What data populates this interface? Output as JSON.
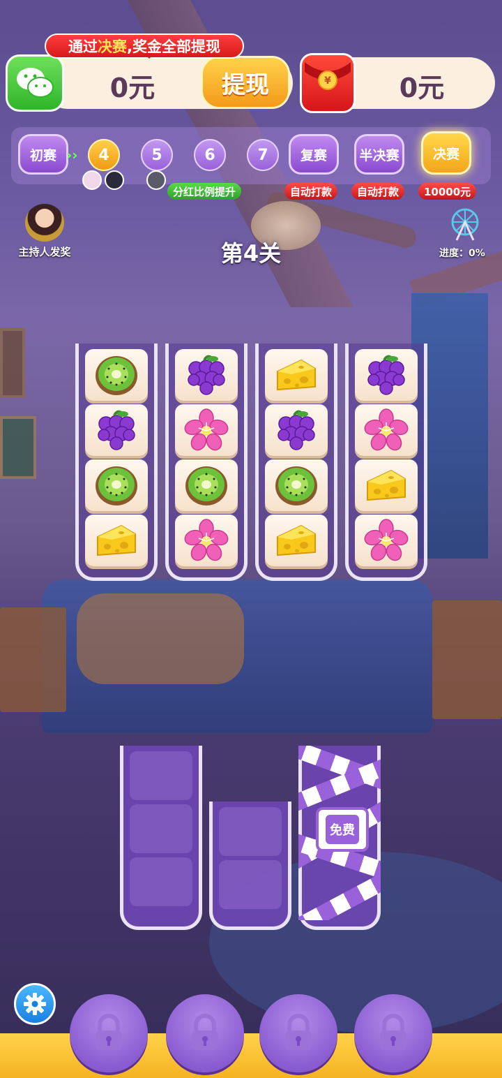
{
  "wallet": {
    "banner_prefix": "通过",
    "banner_highlight": "决赛",
    "banner_suffix": ",奖金全部提现",
    "cash_amount": "0元",
    "withdraw_label": "提现",
    "redpack_amount": "0元"
  },
  "stages": {
    "start": "初赛",
    "levels": [
      "4",
      "5",
      "6",
      "7"
    ],
    "current": "4",
    "repechage": "复赛",
    "semifinal": "半决赛",
    "final": "决赛",
    "tag_dividend": "分红比例提升",
    "tag_auto_pay_1": "自动打款",
    "tag_auto_pay_2": "自动打款",
    "tag_final_prize": "10000元"
  },
  "host_label": "主持人发奖",
  "progress_label": "进度：0%",
  "progress_value": 0,
  "level_title": "第4关",
  "board": {
    "tubes": [
      [
        "kiwi",
        "grape",
        "kiwi",
        "cheese"
      ],
      [
        "grape",
        "flower",
        "kiwi",
        "flower"
      ],
      [
        "cheese",
        "grape",
        "kiwi",
        "cheese"
      ],
      [
        "grape",
        "flower",
        "cheese",
        "flower"
      ]
    ]
  },
  "empty_tubes": {
    "free_label": "免费"
  },
  "colors": {
    "accent_gold": "#f4b322",
    "purple": "#9a62da",
    "wechat_green": "#2fb52a",
    "red": "#d61a1a"
  },
  "icons": {
    "settings": "gear-icon",
    "locked_slot": "lock-icon",
    "wechat": "wechat-icon",
    "redpack": "red-envelope-icon"
  }
}
